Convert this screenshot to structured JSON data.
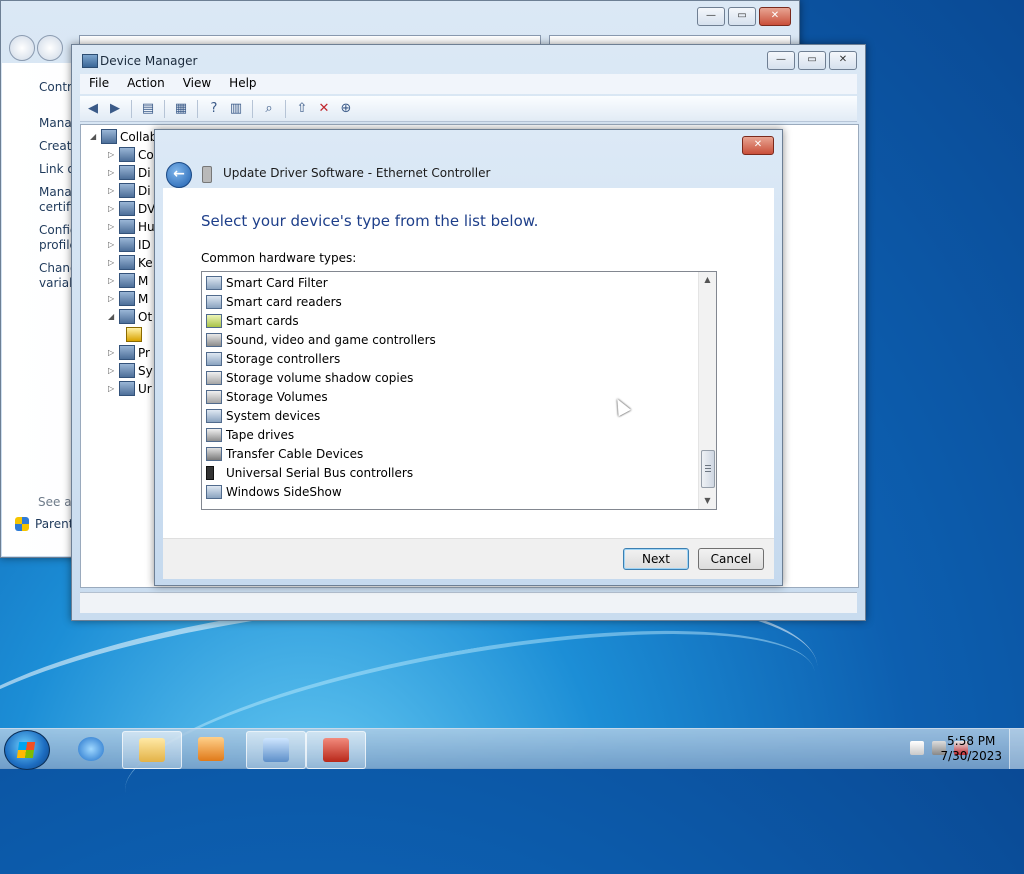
{
  "control_panel": {
    "links": [
      "Control",
      "Manag",
      "Create",
      "Link o",
      "Manag\ncertific",
      "Config\nprofile",
      "Chang\nvariabl"
    ],
    "see_also": "See als",
    "parental": "Parent"
  },
  "device_manager": {
    "title": "Device Manager",
    "menu": [
      "File",
      "Action",
      "View",
      "Help"
    ],
    "tree_root": "Collab",
    "tree_items": [
      "Co",
      "Di",
      "Di",
      "DV",
      "Hu",
      "ID",
      "Ke",
      "M",
      "M",
      "Ot",
      "",
      "Pr",
      "Sy",
      "Ur"
    ]
  },
  "update_driver": {
    "title": "Update Driver Software - Ethernet Controller",
    "heading": "Select your device's type from the list below.",
    "list_label": "Common hardware types:",
    "items": [
      {
        "label": "Smart Card Filter",
        "icon": "smartcard-filter-icon"
      },
      {
        "label": "Smart card readers",
        "icon": "smartcard-reader-icon"
      },
      {
        "label": "Smart cards",
        "icon": "smartcard-icon"
      },
      {
        "label": "Sound, video and game controllers",
        "icon": "speaker-icon"
      },
      {
        "label": "Storage controllers",
        "icon": "storage-controller-icon"
      },
      {
        "label": "Storage volume shadow copies",
        "icon": "drive-icon"
      },
      {
        "label": "Storage Volumes",
        "icon": "drive-icon"
      },
      {
        "label": "System devices",
        "icon": "computer-icon"
      },
      {
        "label": "Tape drives",
        "icon": "tape-drive-icon"
      },
      {
        "label": "Transfer Cable Devices",
        "icon": "cable-icon"
      },
      {
        "label": "Universal Serial Bus controllers",
        "icon": "usb-icon"
      },
      {
        "label": "Windows SideShow",
        "icon": "sideshow-icon"
      }
    ],
    "next_label": "Next",
    "cancel_label": "Cancel"
  },
  "taskbar": {
    "time": "5:58 PM",
    "date": "7/30/2023"
  }
}
